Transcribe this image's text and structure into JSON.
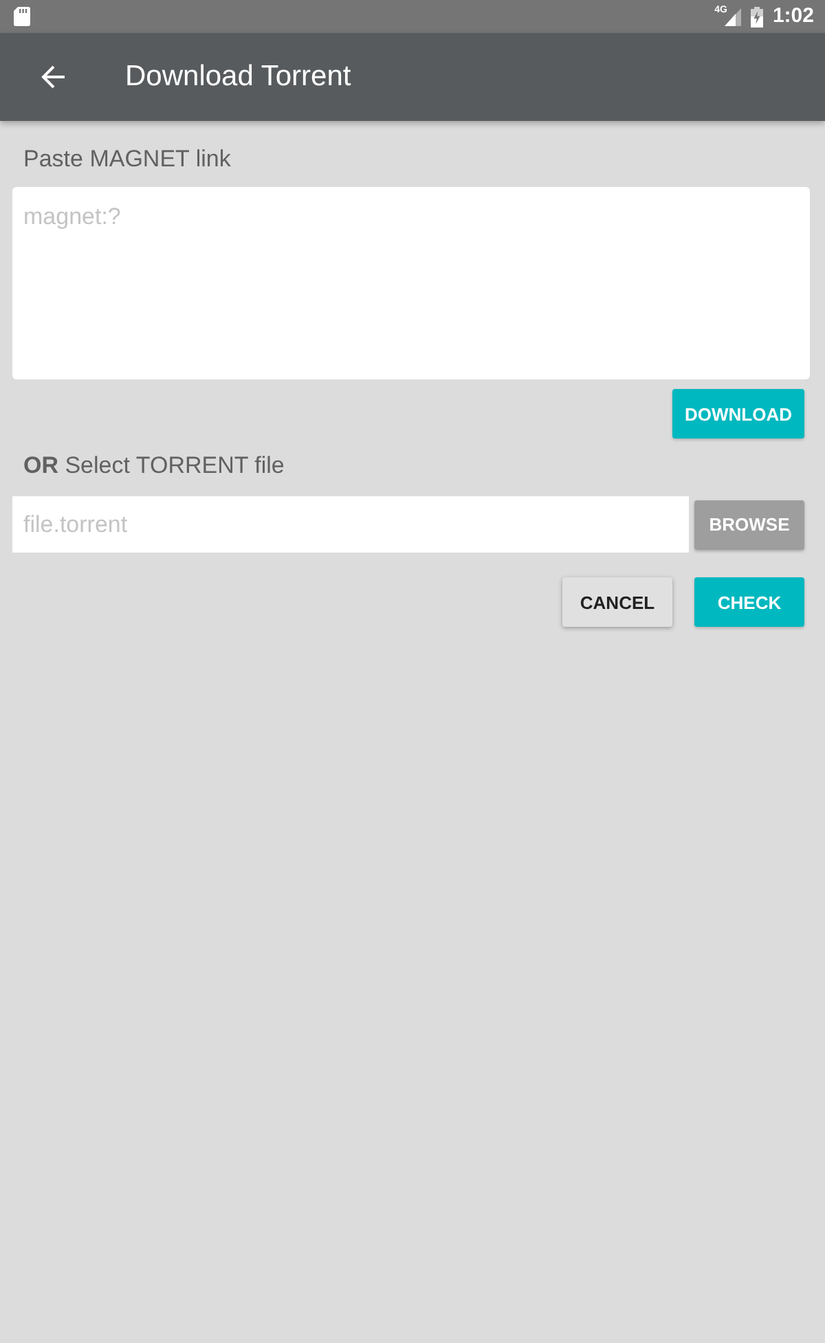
{
  "status_bar": {
    "network": "4G",
    "time": "1:02"
  },
  "app_bar": {
    "title": "Download Torrent"
  },
  "magnet": {
    "label": "Paste MAGNET link",
    "placeholder": "magnet:?",
    "button": {
      "label": "DOWNLOAD",
      "kind": "primary"
    }
  },
  "torrent": {
    "label": "**OR** Select TORRENT file",
    "placeholder": "file.torrent",
    "button": {
      "label": "BROWSE",
      "kind": "secondary"
    }
  },
  "actions": [
    {
      "label": "CANCEL",
      "kind": "flat"
    },
    {
      "label": "CHECK",
      "kind": "primary"
    }
  ]
}
